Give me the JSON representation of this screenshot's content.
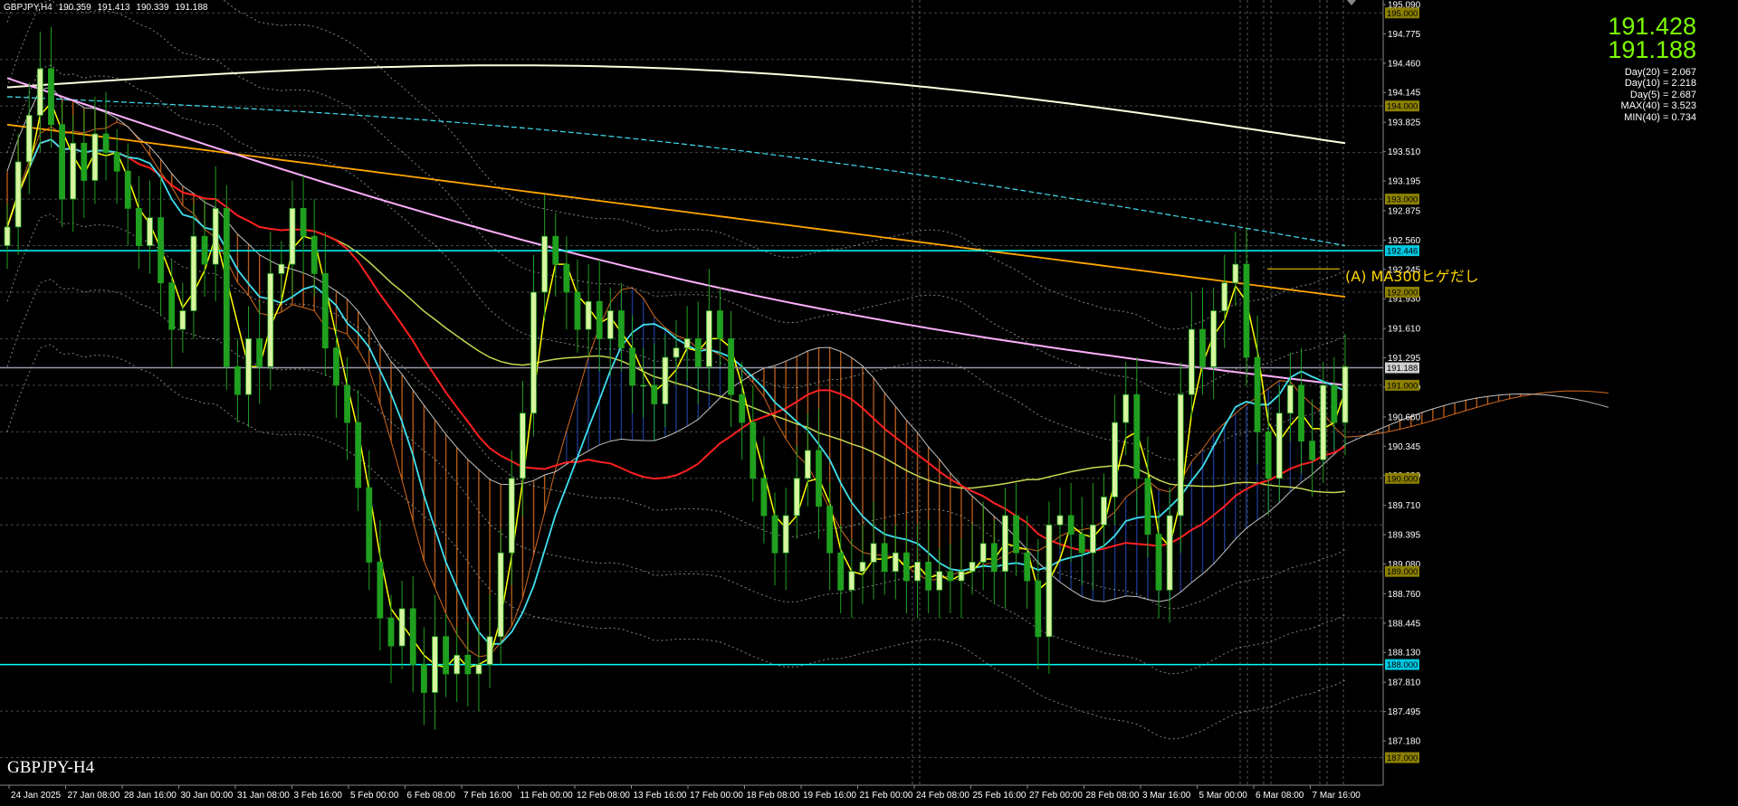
{
  "window": {
    "symbol_header": "GBPJPY,H4",
    "ohlc": [
      "190.359",
      "191.413",
      "190.339",
      "191.188"
    ],
    "symbol_label": "GBPJPY-H4"
  },
  "prices": {
    "ask": "191.428",
    "bid": "191.188"
  },
  "stats": [
    "Day(20) = 2.067",
    "Day(10) = 2.218",
    "Day(5) = 2.687",
    "MAX(40) = 3.523",
    "MIN(40) = 0.734"
  ],
  "annotation": "(A) MA300ヒゲだし",
  "colors": {
    "background": "#000000",
    "grid": "#4a4a4a",
    "candle_up": "#D8F5A0",
    "candle_down": "#1FA01F",
    "ma_fast": "#FFFF00",
    "ma_cyan": "#40E0F0",
    "ma_red": "#FF2020",
    "ma_pink": "#FFB0FF",
    "ma_orange": "#FFA500",
    "ma_long": "#FFFFE0",
    "cloud_red": "#D2691E",
    "cloud_blue": "#2040A0",
    "hline": "#00FFFF",
    "axis_text": "#FFFFFF"
  },
  "chart_data": {
    "type": "candlestick",
    "symbol": "GBPJPY",
    "timeframe": "H4",
    "ylim": [
      187.0,
      195.1
    ],
    "y_ticks": [
      "195.090",
      "194.775",
      "194.460",
      "194.145",
      "193.825",
      "193.510",
      "193.195",
      "192.875",
      "192.560",
      "192.245",
      "191.930",
      "191.610",
      "191.295",
      "190.980",
      "190.660",
      "190.345",
      "190.030",
      "189.710",
      "189.395",
      "189.080",
      "188.760",
      "188.445",
      "188.130",
      "187.810",
      "187.495",
      "187.180"
    ],
    "y_tick_values": [
      195.09,
      194.775,
      194.46,
      194.145,
      193.825,
      193.51,
      193.195,
      192.875,
      192.56,
      192.245,
      191.93,
      191.61,
      191.295,
      190.98,
      190.66,
      190.345,
      190.03,
      189.71,
      189.395,
      189.08,
      188.76,
      188.445,
      188.13,
      187.81,
      187.495,
      187.18
    ],
    "price_tags": [
      {
        "label": "195.000",
        "value": 195.0
      },
      {
        "label": "194.000",
        "value": 194.0
      },
      {
        "label": "193.000",
        "value": 193.0
      },
      {
        "label": "192.446",
        "value": 192.446
      },
      {
        "label": "192.000",
        "value": 192.0
      },
      {
        "label": "191.188",
        "value": 191.188
      },
      {
        "label": "191.000",
        "value": 191.0
      },
      {
        "label": "190.000",
        "value": 190.0
      },
      {
        "label": "189.000",
        "value": 189.0
      },
      {
        "label": "188.000",
        "value": 188.0
      },
      {
        "label": "187.000",
        "value": 187.0
      }
    ],
    "x_labels": [
      "24 Jan 2025",
      "27 Jan 08:00",
      "28 Jan 16:00",
      "30 Jan 00:00",
      "31 Jan 08:00",
      "3 Feb 16:00",
      "5 Feb 00:00",
      "6 Feb 08:00",
      "7 Feb 16:00",
      "11 Feb 00:00",
      "12 Feb 08:00",
      "13 Feb 16:00",
      "17 Feb 00:00",
      "18 Feb 08:00",
      "19 Feb 16:00",
      "21 Feb 00:00",
      "24 Feb 08:00",
      "25 Feb 16:00",
      "27 Feb 00:00",
      "28 Feb 08:00",
      "3 Mar 16:00",
      "5 Mar 00:00",
      "6 Mar 08:00",
      "7 Mar 16:00"
    ],
    "horizontal_lines": [
      192.446,
      188.0,
      191.188
    ],
    "close_path": [
      192.7,
      193.4,
      193.9,
      194.4,
      193.8,
      193.0,
      193.6,
      193.2,
      193.7,
      193.5,
      193.3,
      192.9,
      192.5,
      192.8,
      192.1,
      191.6,
      191.8,
      192.6,
      192.3,
      192.9,
      191.2,
      190.9,
      191.5,
      191.2,
      192.2,
      192.3,
      192.9,
      192.6,
      192.2,
      191.4,
      191.0,
      190.6,
      189.9,
      189.1,
      188.5,
      188.2,
      188.6,
      188.0,
      187.7,
      188.3,
      187.9,
      188.1,
      187.9,
      188.0,
      188.3,
      189.2,
      190.0,
      190.7,
      192.0,
      192.6,
      192.3,
      192.0,
      191.6,
      191.9,
      191.5,
      191.8,
      191.4,
      191.0,
      191.0,
      190.8,
      191.3,
      191.4,
      191.5,
      191.2,
      191.8,
      191.5,
      190.9,
      190.6,
      190.0,
      189.6,
      189.2,
      189.6,
      190.0,
      190.3,
      189.7,
      189.2,
      188.8,
      189.0,
      189.1,
      189.3,
      189.0,
      189.2,
      188.9,
      189.1,
      188.8,
      189.0,
      188.9,
      189.0,
      189.1,
      189.3,
      189.0,
      189.6,
      189.2,
      188.9,
      188.3,
      189.5,
      189.6,
      189.4,
      189.2,
      189.5,
      189.8,
      190.6,
      190.9,
      190.0,
      189.4,
      188.8,
      189.6,
      190.9,
      191.6,
      191.2,
      191.8,
      192.1,
      192.3,
      191.3,
      190.5,
      190.0,
      190.7,
      191.0,
      190.4,
      190.2,
      191.0,
      190.6,
      191.2
    ]
  }
}
